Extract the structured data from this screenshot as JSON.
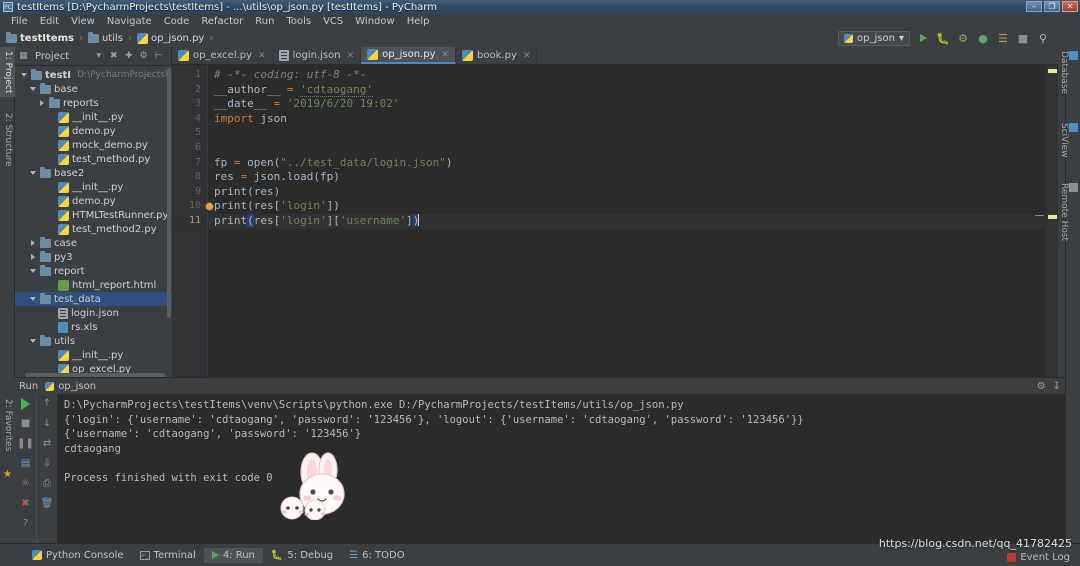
{
  "window": {
    "title": "testItems [D:\\PycharmProjects\\testItems] - ...\\utils\\op_json.py [testItems] - PyCharm",
    "app_icon": "pycharm-icon",
    "minimize": "–",
    "maximize": "❐",
    "close": "✕"
  },
  "menu": {
    "items": [
      "File",
      "Edit",
      "View",
      "Navigate",
      "Code",
      "Refactor",
      "Run",
      "Tools",
      "VCS",
      "Window",
      "Help"
    ]
  },
  "breadcrumb": {
    "items": [
      {
        "label": "testItems",
        "icon": "folder-icon"
      },
      {
        "label": "utils",
        "icon": "folder-icon"
      },
      {
        "label": "op_json.py",
        "icon": "python-file-icon"
      }
    ],
    "separator": "›"
  },
  "toolbar_right": {
    "run_config": "op_json",
    "dropdown_caret": "▾",
    "buttons": [
      "run-icon",
      "debug-icon",
      "coverage-icon",
      "profile-icon",
      "attach-icon",
      "stop-icon",
      "search-icon"
    ]
  },
  "left_rail": {
    "tabs": [
      {
        "label": "1: Project",
        "icon": "project-icon",
        "active": true
      },
      {
        "label": "2: Structure",
        "icon": "structure-icon",
        "active": false
      }
    ],
    "bottom_tabs": [
      {
        "label": "2: Favorites",
        "icon": "star-icon"
      }
    ]
  },
  "right_rail": {
    "tabs": [
      {
        "label": "Database",
        "icon": "database-icon"
      },
      {
        "label": "SciView",
        "icon": "sciview-icon"
      },
      {
        "label": "Remote Host",
        "icon": "remote-host-icon"
      }
    ]
  },
  "project_panel": {
    "title": "Project",
    "dropdown_caret": "▾",
    "icons": [
      "collapse-all-icon",
      "expand-all-icon",
      "settings-icon",
      "hide-icon"
    ],
    "tree": [
      {
        "depth": 0,
        "twisty": "down",
        "icon": "folder-icon",
        "label": "testItems",
        "sub": "D:\\PycharmProjects\\",
        "bold": true,
        "selected": false
      },
      {
        "depth": 1,
        "twisty": "down",
        "icon": "folder-icon",
        "label": "base",
        "sub": "",
        "bold": false,
        "selected": false
      },
      {
        "depth": 2,
        "twisty": "right",
        "icon": "folder-icon",
        "label": "reports",
        "sub": "",
        "bold": false,
        "selected": false
      },
      {
        "depth": 3,
        "twisty": "none",
        "icon": "python-file-icon",
        "label": "__init__.py",
        "sub": "",
        "bold": false,
        "selected": false
      },
      {
        "depth": 3,
        "twisty": "none",
        "icon": "python-file-icon",
        "label": "demo.py",
        "sub": "",
        "bold": false,
        "selected": false
      },
      {
        "depth": 3,
        "twisty": "none",
        "icon": "python-file-icon",
        "label": "mock_demo.py",
        "sub": "",
        "bold": false,
        "selected": false
      },
      {
        "depth": 3,
        "twisty": "none",
        "icon": "python-file-icon",
        "label": "test_method.py",
        "sub": "",
        "bold": false,
        "selected": false
      },
      {
        "depth": 1,
        "twisty": "down",
        "icon": "folder-icon",
        "label": "base2",
        "sub": "",
        "bold": false,
        "selected": false
      },
      {
        "depth": 3,
        "twisty": "none",
        "icon": "python-file-icon",
        "label": "__init__.py",
        "sub": "",
        "bold": false,
        "selected": false
      },
      {
        "depth": 3,
        "twisty": "none",
        "icon": "python-file-icon",
        "label": "demo.py",
        "sub": "",
        "bold": false,
        "selected": false
      },
      {
        "depth": 3,
        "twisty": "none",
        "icon": "python-file-icon",
        "label": "HTMLTestRunner.py",
        "sub": "",
        "bold": false,
        "selected": false
      },
      {
        "depth": 3,
        "twisty": "none",
        "icon": "python-file-icon",
        "label": "test_method2.py",
        "sub": "",
        "bold": false,
        "selected": false
      },
      {
        "depth": 1,
        "twisty": "right",
        "icon": "folder-icon",
        "label": "case",
        "sub": "",
        "bold": false,
        "selected": false
      },
      {
        "depth": 1,
        "twisty": "right",
        "icon": "folder-icon",
        "label": "py3",
        "sub": "",
        "bold": false,
        "selected": false
      },
      {
        "depth": 1,
        "twisty": "down",
        "icon": "folder-icon",
        "label": "report",
        "sub": "",
        "bold": false,
        "selected": false
      },
      {
        "depth": 3,
        "twisty": "none",
        "icon": "html-file-icon",
        "label": "html_report.html",
        "sub": "",
        "bold": false,
        "selected": false
      },
      {
        "depth": 1,
        "twisty": "down",
        "icon": "folder-icon",
        "label": "test_data",
        "sub": "",
        "bold": false,
        "selected": true
      },
      {
        "depth": 3,
        "twisty": "none",
        "icon": "json-file-icon",
        "label": "login.json",
        "sub": "",
        "bold": false,
        "selected": false
      },
      {
        "depth": 3,
        "twisty": "none",
        "icon": "xls-file-icon",
        "label": "rs.xls",
        "sub": "",
        "bold": false,
        "selected": false
      },
      {
        "depth": 1,
        "twisty": "down",
        "icon": "folder-icon",
        "label": "utils",
        "sub": "",
        "bold": false,
        "selected": false
      },
      {
        "depth": 3,
        "twisty": "none",
        "icon": "python-file-icon",
        "label": "__init__.py",
        "sub": "",
        "bold": false,
        "selected": false
      },
      {
        "depth": 3,
        "twisty": "none",
        "icon": "python-file-icon",
        "label": "op_excel.py",
        "sub": "",
        "bold": false,
        "selected": false
      }
    ]
  },
  "editor": {
    "tabs": [
      {
        "label": "op_excel.py",
        "icon": "python-file-icon",
        "active": false,
        "close": "✕"
      },
      {
        "label": "login.json",
        "icon": "json-file-icon",
        "active": false,
        "close": "✕"
      },
      {
        "label": "op_json.py",
        "icon": "python-file-icon",
        "active": true,
        "close": "✕"
      },
      {
        "label": "book.py",
        "icon": "python-file-icon",
        "active": false,
        "close": "✕"
      }
    ],
    "line_numbers": [
      "1",
      "2",
      "3",
      "4",
      "5",
      "6",
      "7",
      "8",
      "9",
      "10",
      "11"
    ],
    "current_line": 11,
    "bulb_line": 10,
    "code": [
      "# -*- coding: utf-8 -*-",
      "__author__ = 'cdtaogang'",
      "__date__ = '2019/6/20 19:02'",
      "import json",
      "",
      "",
      "fp = open(\"../test_data/login.json\")",
      "res = json.load(fp)",
      "print(res)",
      "print(res['login'])",
      "print(res['login']['username'])"
    ]
  },
  "run_panel": {
    "title": "Run",
    "config_name": "op_json",
    "config_icon": "python-icon",
    "header_icons": [
      "settings-icon",
      "hide-icon"
    ],
    "tool_icons_col1": [
      "rerun-icon",
      "stop-icon",
      "pause-icon",
      "console-icon",
      "attach-icon",
      "close-icon",
      "help-icon"
    ],
    "tool_icons_col2": [
      "scroll-up-icon",
      "scroll-down-icon",
      "soft-wrap-icon",
      "scroll-to-end-icon",
      "print-icon",
      "trash-icon"
    ],
    "output": [
      "D:\\PycharmProjects\\testItems\\venv\\Scripts\\python.exe D:/PycharmProjects/testItems/utils/op_json.py",
      "{'login': {'username': 'cdtaogang', 'password': '123456'}, 'logout': {'username': 'cdtaogang', 'password': '123456'}}",
      "{'username': 'cdtaogang', 'password': '123456'}",
      "cdtaogang",
      "",
      "Process finished with exit code 0"
    ]
  },
  "status_bar": {
    "items": [
      {
        "label": "Python Console",
        "icon": "python-icon",
        "active": false
      },
      {
        "label": "Terminal",
        "icon": "terminal-icon",
        "active": false
      },
      {
        "label": "4: Run",
        "icon": "run-icon",
        "active": true
      },
      {
        "label": "5: Debug",
        "icon": "debug-icon",
        "active": false
      },
      {
        "label": "6: TODO",
        "icon": "todo-icon",
        "active": false
      }
    ],
    "event_log": "Event Log",
    "event_log_icon": "event-log-icon"
  },
  "watermark": {
    "text": "https://blog.csdn.net/qq_41782425"
  },
  "colors": {
    "accent_blue": "#4a88c7",
    "selection": "#2f4f7f",
    "editor_bg": "#2b2b2b",
    "panel_bg": "#3c3f41",
    "string_green": "#6a8759",
    "keyword_orange": "#cc7832",
    "comment_grey": "#808080"
  }
}
